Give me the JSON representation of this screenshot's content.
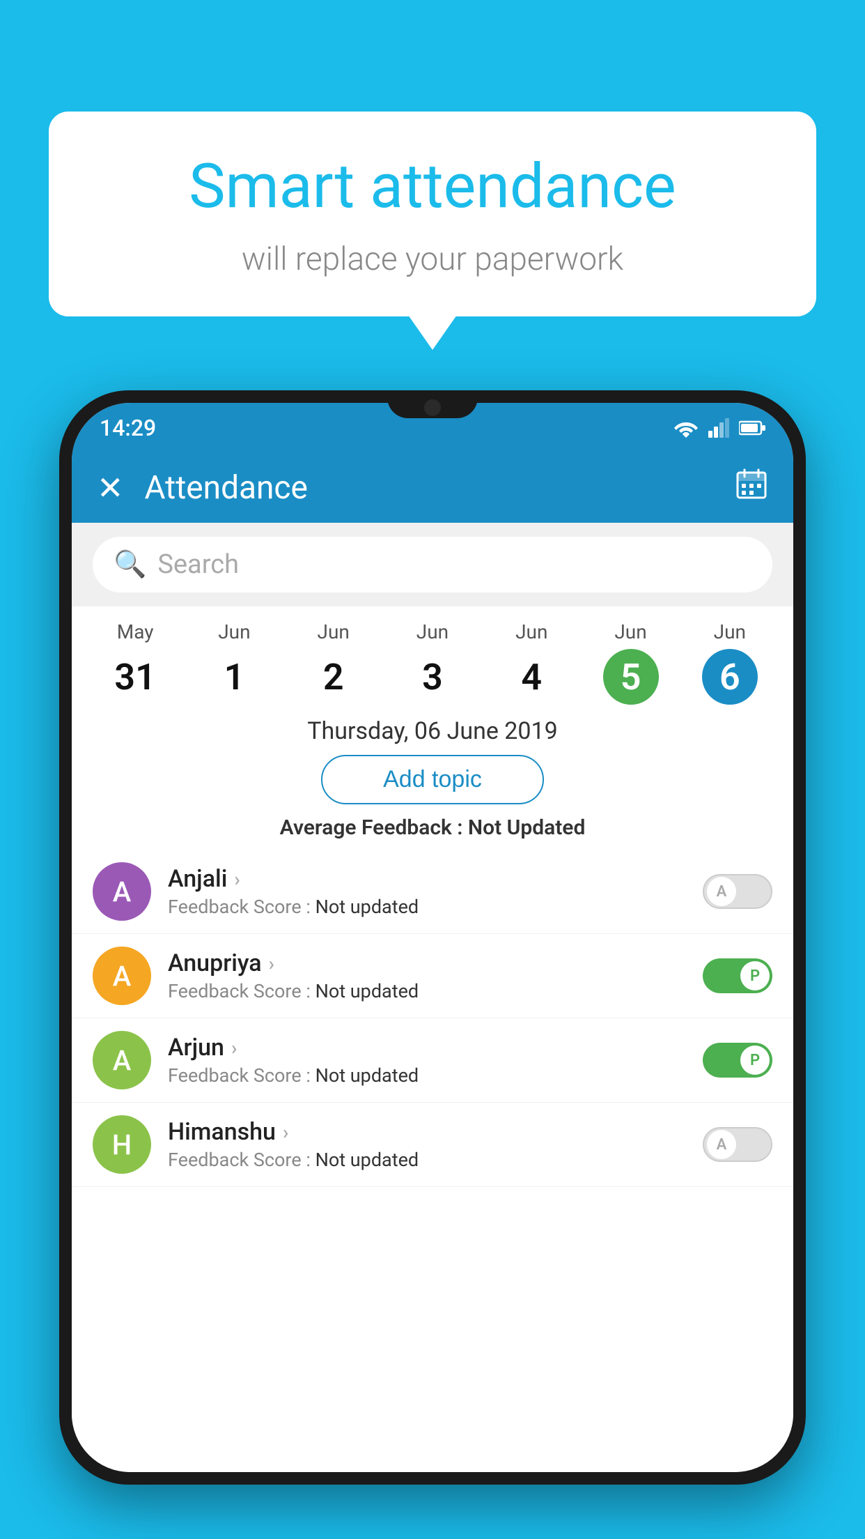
{
  "background_color": "#1BBBEA",
  "speech_bubble": {
    "title": "Smart attendance",
    "subtitle": "will replace your paperwork"
  },
  "status_bar": {
    "time": "14:29"
  },
  "app_bar": {
    "title": "Attendance",
    "close_label": "✕",
    "calendar_label": "📅"
  },
  "search": {
    "placeholder": "Search"
  },
  "calendar": {
    "days": [
      {
        "month": "May",
        "date": "31",
        "style": "normal"
      },
      {
        "month": "Jun",
        "date": "1",
        "style": "normal"
      },
      {
        "month": "Jun",
        "date": "2",
        "style": "normal"
      },
      {
        "month": "Jun",
        "date": "3",
        "style": "normal"
      },
      {
        "month": "Jun",
        "date": "4",
        "style": "normal"
      },
      {
        "month": "Jun",
        "date": "5",
        "style": "today"
      },
      {
        "month": "Jun",
        "date": "6",
        "style": "selected"
      }
    ]
  },
  "selected_date": "Thursday, 06 June 2019",
  "add_topic_label": "Add topic",
  "avg_feedback_label": "Average Feedback :",
  "avg_feedback_value": "Not Updated",
  "students": [
    {
      "name": "Anjali",
      "initial": "A",
      "avatar_color": "#9B59B6",
      "feedback_label": "Feedback Score :",
      "feedback_value": "Not updated",
      "toggle_state": "off",
      "toggle_label": "A"
    },
    {
      "name": "Anupriya",
      "initial": "A",
      "avatar_color": "#F5A623",
      "feedback_label": "Feedback Score :",
      "feedback_value": "Not updated",
      "toggle_state": "on",
      "toggle_label": "P"
    },
    {
      "name": "Arjun",
      "initial": "A",
      "avatar_color": "#8BC34A",
      "feedback_label": "Feedback Score :",
      "feedback_value": "Not updated",
      "toggle_state": "on",
      "toggle_label": "P"
    },
    {
      "name": "Himanshu",
      "initial": "H",
      "avatar_color": "#8BC34A",
      "feedback_label": "Feedback Score :",
      "feedback_value": "Not updated",
      "toggle_state": "off",
      "toggle_label": "A"
    }
  ]
}
